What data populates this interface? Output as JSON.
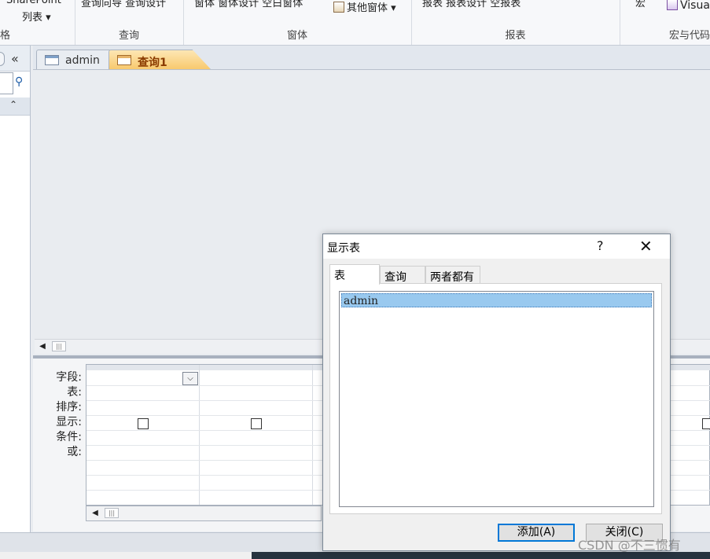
{
  "ribbon": {
    "col1_top": "SharePoint",
    "col1_bottom": "列表 ▾",
    "group1_label": "格",
    "query_top": "查询向导  查询设计",
    "group_query": "查询",
    "form_top": "窗体   窗体设计  空白窗体",
    "form_more": "其他窗体 ▾",
    "group_form": "窗体",
    "report_top": "报表   报表设计  空报表",
    "group_report": "报表",
    "macro_top": "宏",
    "vba_label": "Visua",
    "group_macro": "宏与代码"
  },
  "nav": {
    "collapse_glyph": "«",
    "section_arrow": "⌃"
  },
  "tabs": [
    {
      "label": "admin"
    },
    {
      "label": "查询1"
    }
  ],
  "grid": {
    "row_labels": [
      "字段:",
      "表:",
      "排序:",
      "显示:",
      "条件:",
      "或:"
    ]
  },
  "dialog": {
    "title": "显示表",
    "help": "?",
    "close": "✕",
    "tabs": [
      "表",
      "查询",
      "两者都有"
    ],
    "list_items": [
      "admin"
    ],
    "add_button": "添加(A)",
    "close_button": "关闭(C)"
  },
  "watermark": "CSDN @不三惯有"
}
